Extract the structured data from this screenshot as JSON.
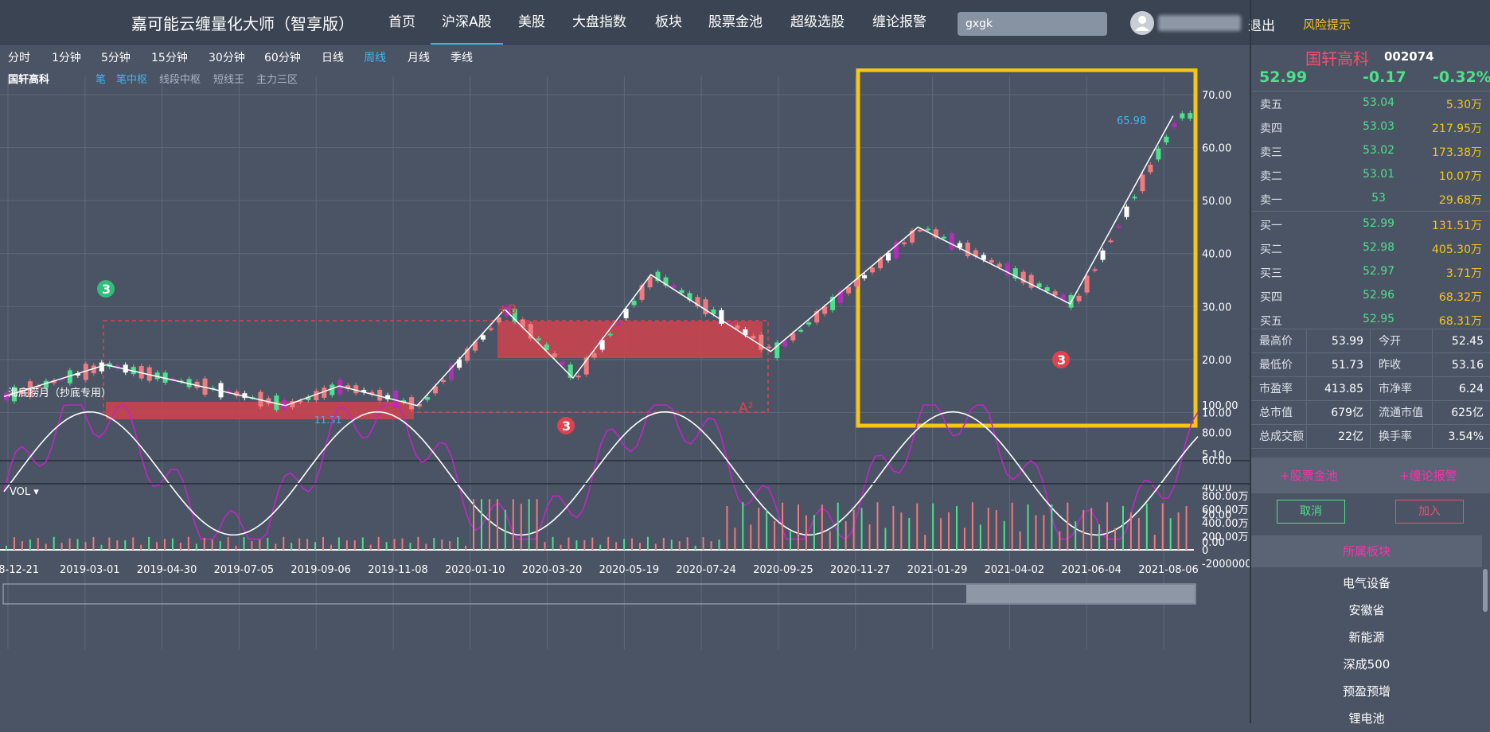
{
  "app": {
    "title": "嘉可能云缠量化大师（智享版）"
  },
  "nav": [
    {
      "label": "首页",
      "active": false
    },
    {
      "label": "沪深A股",
      "active": true
    },
    {
      "label": "美股",
      "active": false
    },
    {
      "label": "大盘指数",
      "active": false
    },
    {
      "label": "板块",
      "active": false
    },
    {
      "label": "股票金池",
      "active": false
    },
    {
      "label": "超级选股",
      "active": false
    },
    {
      "label": "缠论报警",
      "active": false
    }
  ],
  "search": {
    "value": "gxgk"
  },
  "user": {
    "logout": "退出",
    "risk": "风险提示"
  },
  "periods": [
    {
      "label": "分时",
      "active": false
    },
    {
      "label": "1分钟",
      "active": false
    },
    {
      "label": "5分钟",
      "active": false
    },
    {
      "label": "15分钟",
      "active": false
    },
    {
      "label": "30分钟",
      "active": false
    },
    {
      "label": "60分钟",
      "active": false
    },
    {
      "label": "日线",
      "active": false
    },
    {
      "label": "周线",
      "active": true
    },
    {
      "label": "月线",
      "active": false
    },
    {
      "label": "季线",
      "active": false
    }
  ],
  "chart_toolbar": {
    "stock_label": "国轩高科",
    "tools": [
      {
        "label": "笔",
        "color": "#3fb6f0"
      },
      {
        "label": "笔中枢",
        "color": "#3fb6f0"
      },
      {
        "label": "线段中枢",
        "color": "#aab4c2"
      },
      {
        "label": "短线王",
        "color": "#aab4c2"
      },
      {
        "label": "主力三区",
        "color": "#aab4c2"
      }
    ]
  },
  "stock": {
    "name": "国轩高科",
    "code": "002074",
    "price": "52.99",
    "change": "-0.17",
    "change_pct": "-0.32%"
  },
  "order_book": {
    "asks": [
      {
        "label": "卖五",
        "price": "53.04",
        "vol": "5.30万"
      },
      {
        "label": "卖四",
        "price": "53.03",
        "vol": "217.95万"
      },
      {
        "label": "卖三",
        "price": "53.02",
        "vol": "173.38万"
      },
      {
        "label": "卖二",
        "price": "53.01",
        "vol": "10.07万"
      },
      {
        "label": "卖一",
        "price": "53",
        "vol": "29.68万"
      }
    ],
    "bids": [
      {
        "label": "买一",
        "price": "52.99",
        "vol": "131.51万"
      },
      {
        "label": "买二",
        "price": "52.98",
        "vol": "405.30万"
      },
      {
        "label": "买三",
        "price": "52.97",
        "vol": "3.71万"
      },
      {
        "label": "买四",
        "price": "52.96",
        "vol": "68.32万"
      },
      {
        "label": "买五",
        "price": "52.95",
        "vol": "68.31万"
      }
    ]
  },
  "stats": [
    {
      "l1": "最高价",
      "v1": "53.99",
      "l2": "今开",
      "v2": "52.45"
    },
    {
      "l1": "最低价",
      "v1": "51.73",
      "l2": "昨收",
      "v2": "53.16"
    },
    {
      "l1": "市盈率",
      "v1": "413.85",
      "l2": "市净率",
      "v2": "6.24"
    },
    {
      "l1": "总市值",
      "v1": "679亿",
      "l2": "流通市值",
      "v2": "625亿"
    },
    {
      "l1": "总成交额",
      "v1": "22亿",
      "l2": "换手率",
      "v2": "3.54%"
    }
  ],
  "actions": {
    "pool": "+股票金池",
    "alarm": "+缠论报警",
    "cancel": "取消",
    "add": "加入"
  },
  "sectors": {
    "title": "所属板块",
    "items": [
      "电气设备",
      "安徽省",
      "新能源",
      "深成500",
      "预盈预增",
      "锂电池"
    ]
  },
  "chart_data": [
    {
      "type": "candlestick",
      "title": "",
      "x_dates": [
        "18-12-21",
        "2019-03-01",
        "2019-04-30",
        "2019-07-05",
        "2019-09-06",
        "2019-11-08",
        "2020-01-10",
        "2020-03-20",
        "2020-05-19",
        "2020-07-24",
        "2020-09-25",
        "2020-11-27",
        "2021-01-29",
        "2021-04-02",
        "2021-06-04",
        "2021-08-06"
      ],
      "y_ticks": [
        10,
        20,
        30,
        40,
        50,
        60,
        70
      ],
      "y_extra_label": "5.10",
      "ylim": [
        5.1,
        75
      ],
      "annotations": [
        {
          "text": "65.98"
        },
        {
          "text": "11.31"
        },
        {
          "text": "+B"
        },
        {
          "text": "A²"
        },
        {
          "text": "3"
        }
      ],
      "pen_points": [
        [
          0,
          13
        ],
        [
          0.085,
          19
        ],
        [
          0.235,
          11.3
        ],
        [
          0.28,
          15
        ],
        [
          0.345,
          11.3
        ],
        [
          0.418,
          29.5
        ],
        [
          0.475,
          16.5
        ],
        [
          0.54,
          36
        ],
        [
          0.64,
          21.5
        ],
        [
          0.763,
          45
        ],
        [
          0.89,
          30.5
        ],
        [
          0.976,
          66
        ]
      ]
    },
    {
      "type": "line",
      "title": "海底捞月（抄底专用）",
      "y_ticks": [
        0,
        20,
        40,
        60,
        80,
        100
      ],
      "ylim": [
        0,
        100
      ]
    },
    {
      "type": "bar",
      "title": "VOL",
      "y_ticks": [
        "-2000000",
        "0",
        "200.00万",
        "400.00万",
        "600.00万",
        "800.00万"
      ],
      "ylim": [
        -2000000,
        8000000
      ]
    }
  ]
}
